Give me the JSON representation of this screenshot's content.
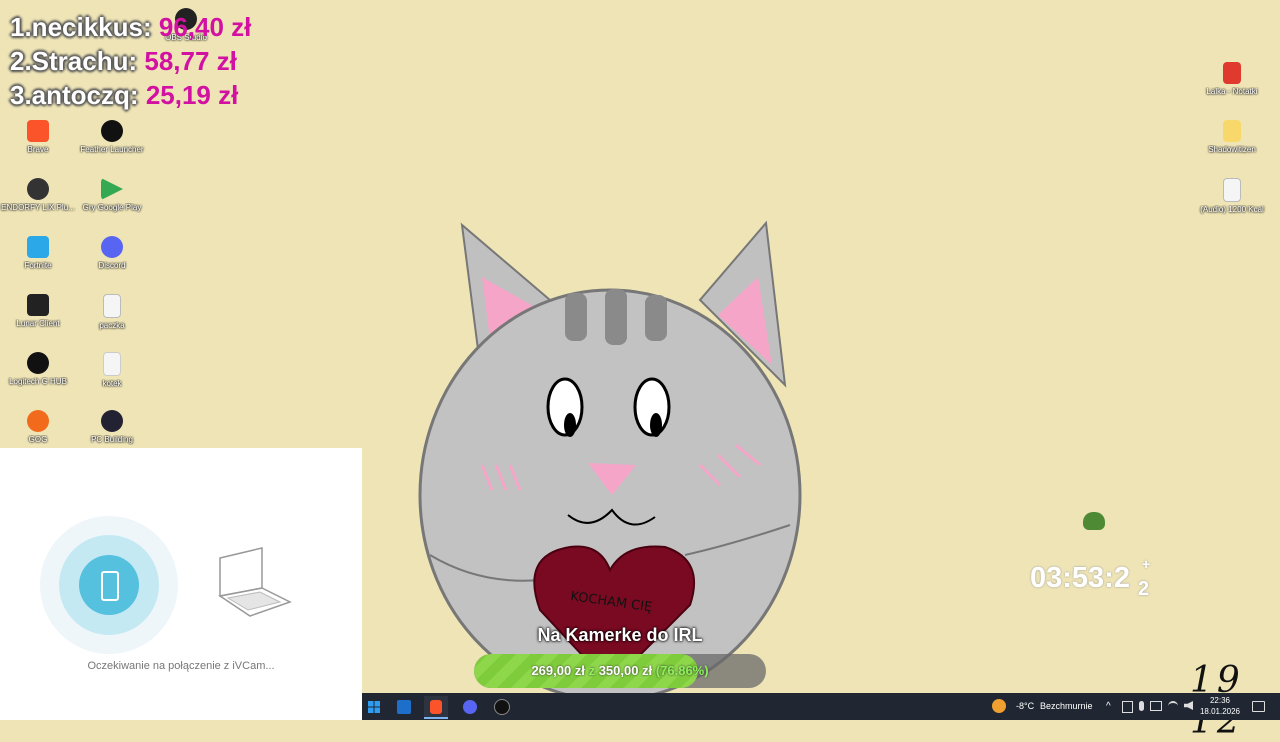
{
  "leaderboard": [
    {
      "name": "1.necikkus:",
      "amount": "96,40 zł"
    },
    {
      "name": "2.Strachu:",
      "amount": "58,77 zł"
    },
    {
      "name": "3.antoczq:",
      "amount": "25,19 zł"
    }
  ],
  "desktop_icons": {
    "brave": "Brave",
    "feather": "Feather Launcher",
    "endorfy": "ENDORFY LIX Plu...",
    "gry_google_play": "Gry Google Play",
    "fortnite": "Fortnite",
    "discord": "Discord",
    "lunar": "Lunar Client",
    "paczka": "paczka",
    "logitech": "Logitech G HUB",
    "kotek": "kotek",
    "gog": "GOG",
    "pc_building": "PC Building",
    "obs": "OBS Studio",
    "pdf": "Lalka - Notatki",
    "folder": "Shadowitizen",
    "audio": "(Audio) 1200 Kcal"
  },
  "ivcam": {
    "status": "Oczekiwanie na połączenie z iVCam..."
  },
  "goal": {
    "title": "Na Kamerke do IRL",
    "current": "269,00 zł",
    "separator": "z",
    "target": "350,00 zł",
    "percent_label": "(76.86%)",
    "progress": 0.7686
  },
  "timer": {
    "value": "03:53:2",
    "sub": "2",
    "sup": "+"
  },
  "handwritten_number": "19 12",
  "drawing_text": "KOCHAM CIĘ",
  "taskbar": {
    "weather_temp": "-8°C",
    "weather_desc": "Bezchmurnie",
    "time": "22:36",
    "date": "18.01.2026"
  },
  "colors": {
    "desktop_bg": "#eee4b6",
    "leaderboard_amount": "#d211a3",
    "goal_fill": "#7ecb3b",
    "taskbar_bg": "#202732"
  }
}
